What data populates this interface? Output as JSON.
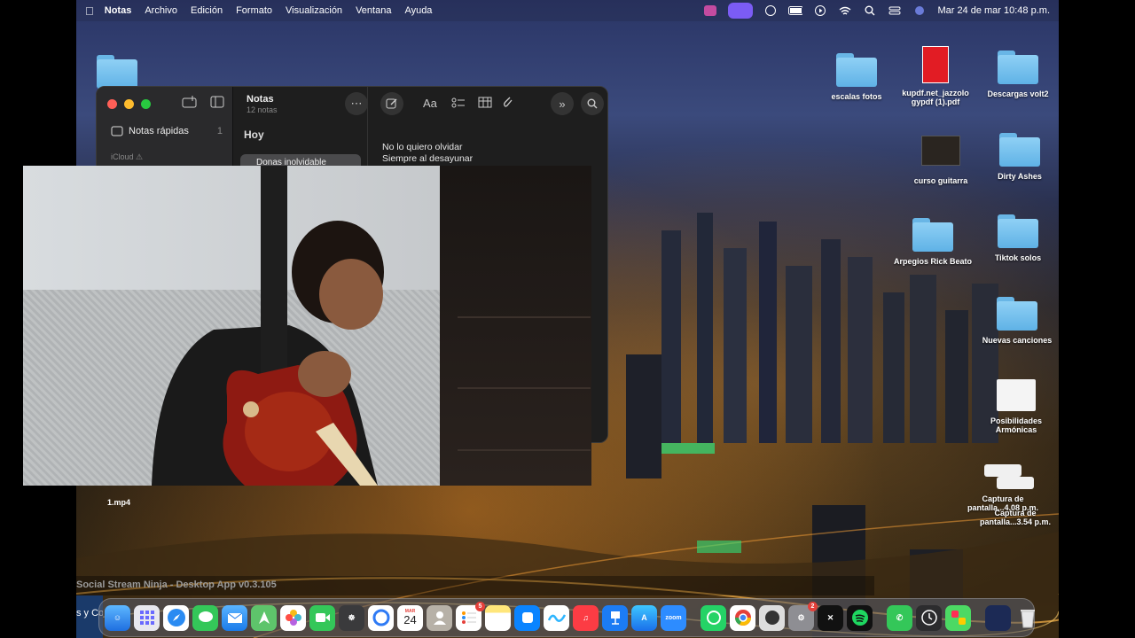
{
  "menubar": {
    "app_name": "Notas",
    "menus": [
      "Archivo",
      "Edición",
      "Formato",
      "Visualización",
      "Ventana",
      "Ayuda"
    ],
    "datetime": "Mar 24 de mar  10:48 p.m."
  },
  "desktop_icons": [
    {
      "label": "escalas fotos",
      "kind": "folder"
    },
    {
      "label": "kupdf.net_jazzolo gypdf (1).pdf",
      "kind": "pdf"
    },
    {
      "label": "Descargas volt2",
      "kind": "folder"
    },
    {
      "label": "curso guitarra",
      "kind": "image"
    },
    {
      "label": "Dirty Ashes",
      "kind": "folder"
    },
    {
      "label": "Arpegios Rick Beato",
      "kind": "folder"
    },
    {
      "label": "Tiktok solos",
      "kind": "folder"
    },
    {
      "label": "Nuevas canciones",
      "kind": "folder"
    },
    {
      "label": "Posibilidades Armónicas",
      "kind": "document"
    },
    {
      "label": "Captura de pantalla...4.08 p.m.",
      "kind": "screenshot"
    },
    {
      "label": "Captura de pantalla...3.54 p.m.",
      "kind": "screenshot"
    }
  ],
  "notes_window": {
    "sidebar": {
      "quick_notes_label": "Notas rápidas",
      "quick_notes_count": "1",
      "icloud_label": "iCloud"
    },
    "list": {
      "title": "Notas",
      "subtitle": "12 notas",
      "section": "Hoy",
      "selected_note": "Donas inolvidable"
    },
    "editor_lines": [
      "No lo quiero olvidar",
      "Siempre al desayunar"
    ]
  },
  "file_label": "1.mp4",
  "social_stream_title": "Social Stream Ninja - Desktop App v0.3.105",
  "social_stream_left_text": "s y Co",
  "dock": {
    "calendar_day": "24",
    "calendar_month": "MAR",
    "reminders_badge": "5",
    "settings_badge": "2",
    "zoom_label": "zoom"
  }
}
